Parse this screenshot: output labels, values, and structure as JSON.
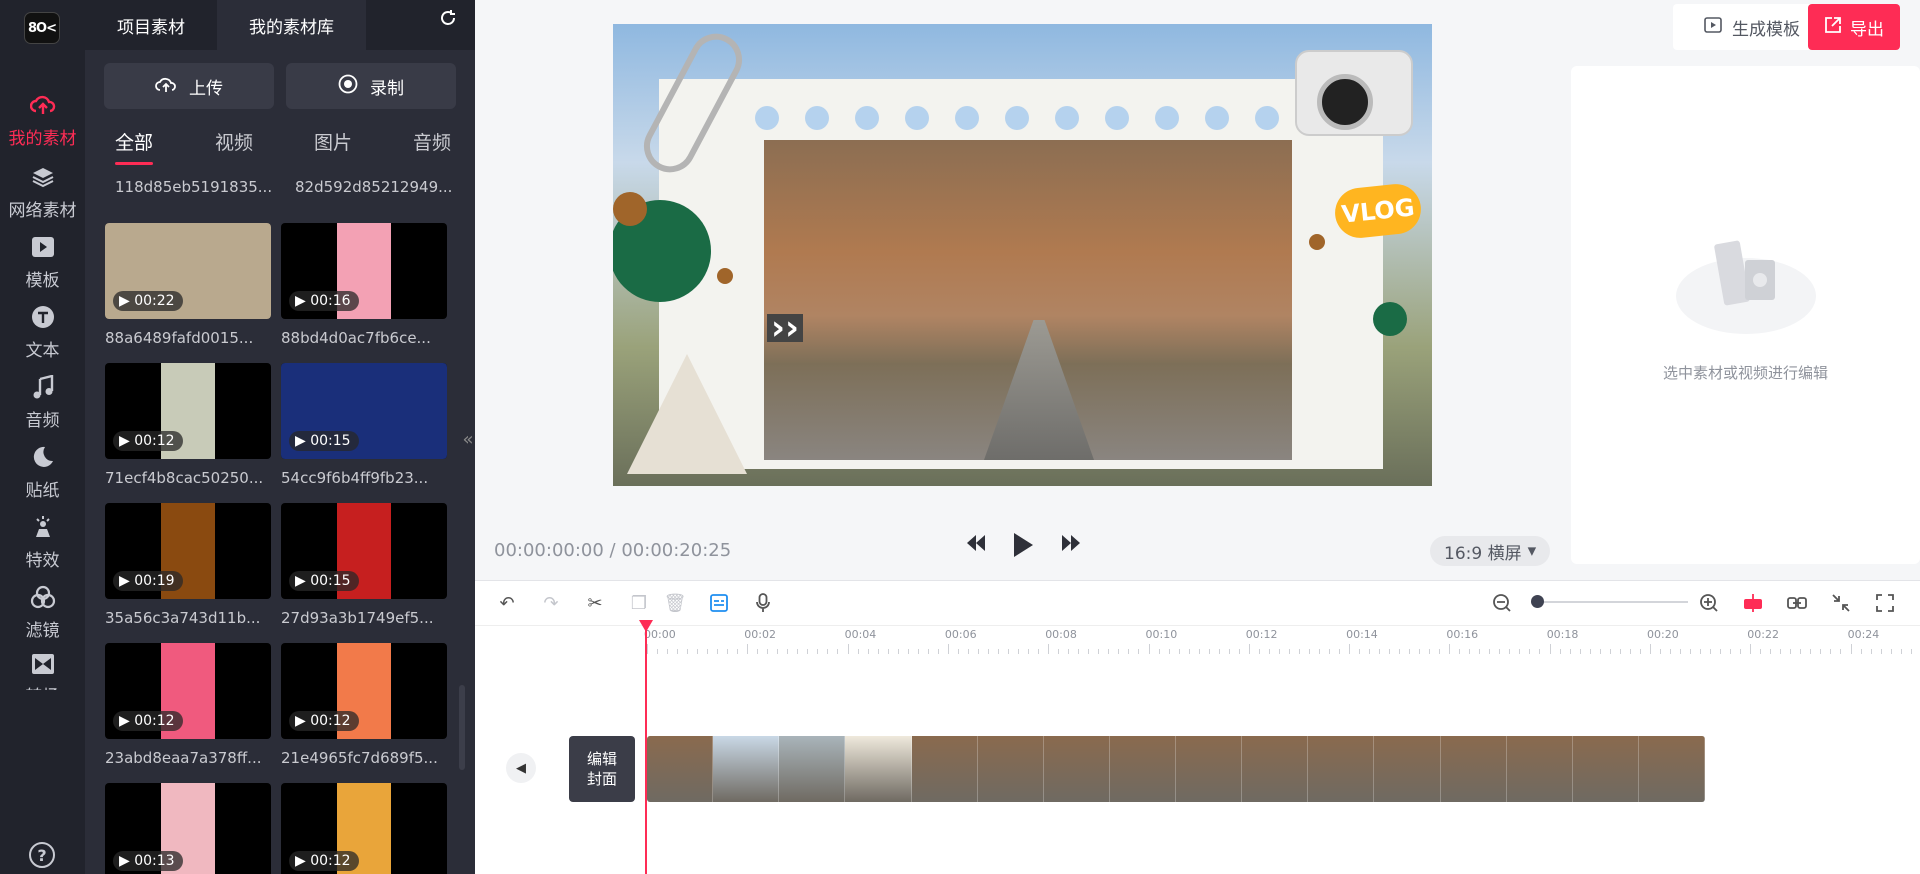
{
  "app": {
    "logo_text": "8O<"
  },
  "rail": {
    "items": [
      {
        "label": "我的素材",
        "icon": "cloud-upload-icon",
        "active": true
      },
      {
        "label": "网络素材",
        "icon": "layers-icon",
        "active": false
      },
      {
        "label": "模板",
        "icon": "play-square-icon",
        "active": false
      },
      {
        "label": "文本",
        "icon": "text-t-icon",
        "active": false
      },
      {
        "label": "音频",
        "icon": "music-note-icon",
        "active": false
      },
      {
        "label": "贴纸",
        "icon": "moon-icon",
        "active": false
      },
      {
        "label": "特效",
        "icon": "magic-effect-icon",
        "active": false
      },
      {
        "label": "滤镜",
        "icon": "filter-circles-icon",
        "active": false
      },
      {
        "label": "转场",
        "icon": "transition-icon",
        "active": false
      }
    ],
    "help_icon": "help-circle-icon"
  },
  "panel": {
    "tabs": [
      {
        "label": "项目素材",
        "active": false
      },
      {
        "label": "我的素材库",
        "active": true
      }
    ],
    "refresh_icon": "refresh-icon",
    "upload_label": "上传",
    "record_label": "录制",
    "filters": [
      {
        "label": "全部",
        "active": true
      },
      {
        "label": "视频",
        "active": false
      },
      {
        "label": "图片",
        "active": false
      },
      {
        "label": "音频",
        "active": false
      }
    ],
    "partial_captions": [
      "118d85eb5191835...",
      "82d592d85212949..."
    ],
    "cards": [
      {
        "duration": "00:22",
        "name": "88a6489fafd0015...",
        "color": "#b9a98e"
      },
      {
        "duration": "00:16",
        "name": "88bd4d0ac7fb6ce...",
        "color": "#f3a1b4"
      },
      {
        "duration": "00:12",
        "name": "71ecf4b8cac50250...",
        "color": "#c8cbb8"
      },
      {
        "duration": "00:15",
        "name": "54cc9f6b4ff9fb23...",
        "color": "#1a2f7a"
      },
      {
        "duration": "00:19",
        "name": "35a56c3a743d11b...",
        "color": "#8a4a10"
      },
      {
        "duration": "00:15",
        "name": "27d93a3b1749ef5...",
        "color": "#c61f1f"
      },
      {
        "duration": "00:12",
        "name": "23abd8eaa7a378ff...",
        "color": "#f05a7e"
      },
      {
        "duration": "00:12",
        "name": "21e4965fc7d689f5...",
        "color": "#f27a4a"
      },
      {
        "duration": "00:13",
        "name": "",
        "color": "#f0b8c0"
      },
      {
        "duration": "00:12",
        "name": "",
        "color": "#e9a53a"
      }
    ]
  },
  "preview": {
    "vlog_text": "VLOG",
    "current_time": "00:00:00:00",
    "total_time": "00:00:20:25",
    "time_separator": "/",
    "ratio_label": "16:9 横屏"
  },
  "header": {
    "template_button": "生成模板",
    "export_button": "导出"
  },
  "right_panel": {
    "hint": "选中素材或视频进行编辑"
  },
  "timeline": {
    "ticks": [
      "00:00",
      "00:02",
      "00:04",
      "00:06",
      "00:08",
      "00:10",
      "00:12",
      "00:14",
      "00:16",
      "00:18",
      "00:20",
      "00:22",
      "00:24"
    ],
    "cover_label": "编辑\n封面",
    "zoom_level": 0.0
  }
}
